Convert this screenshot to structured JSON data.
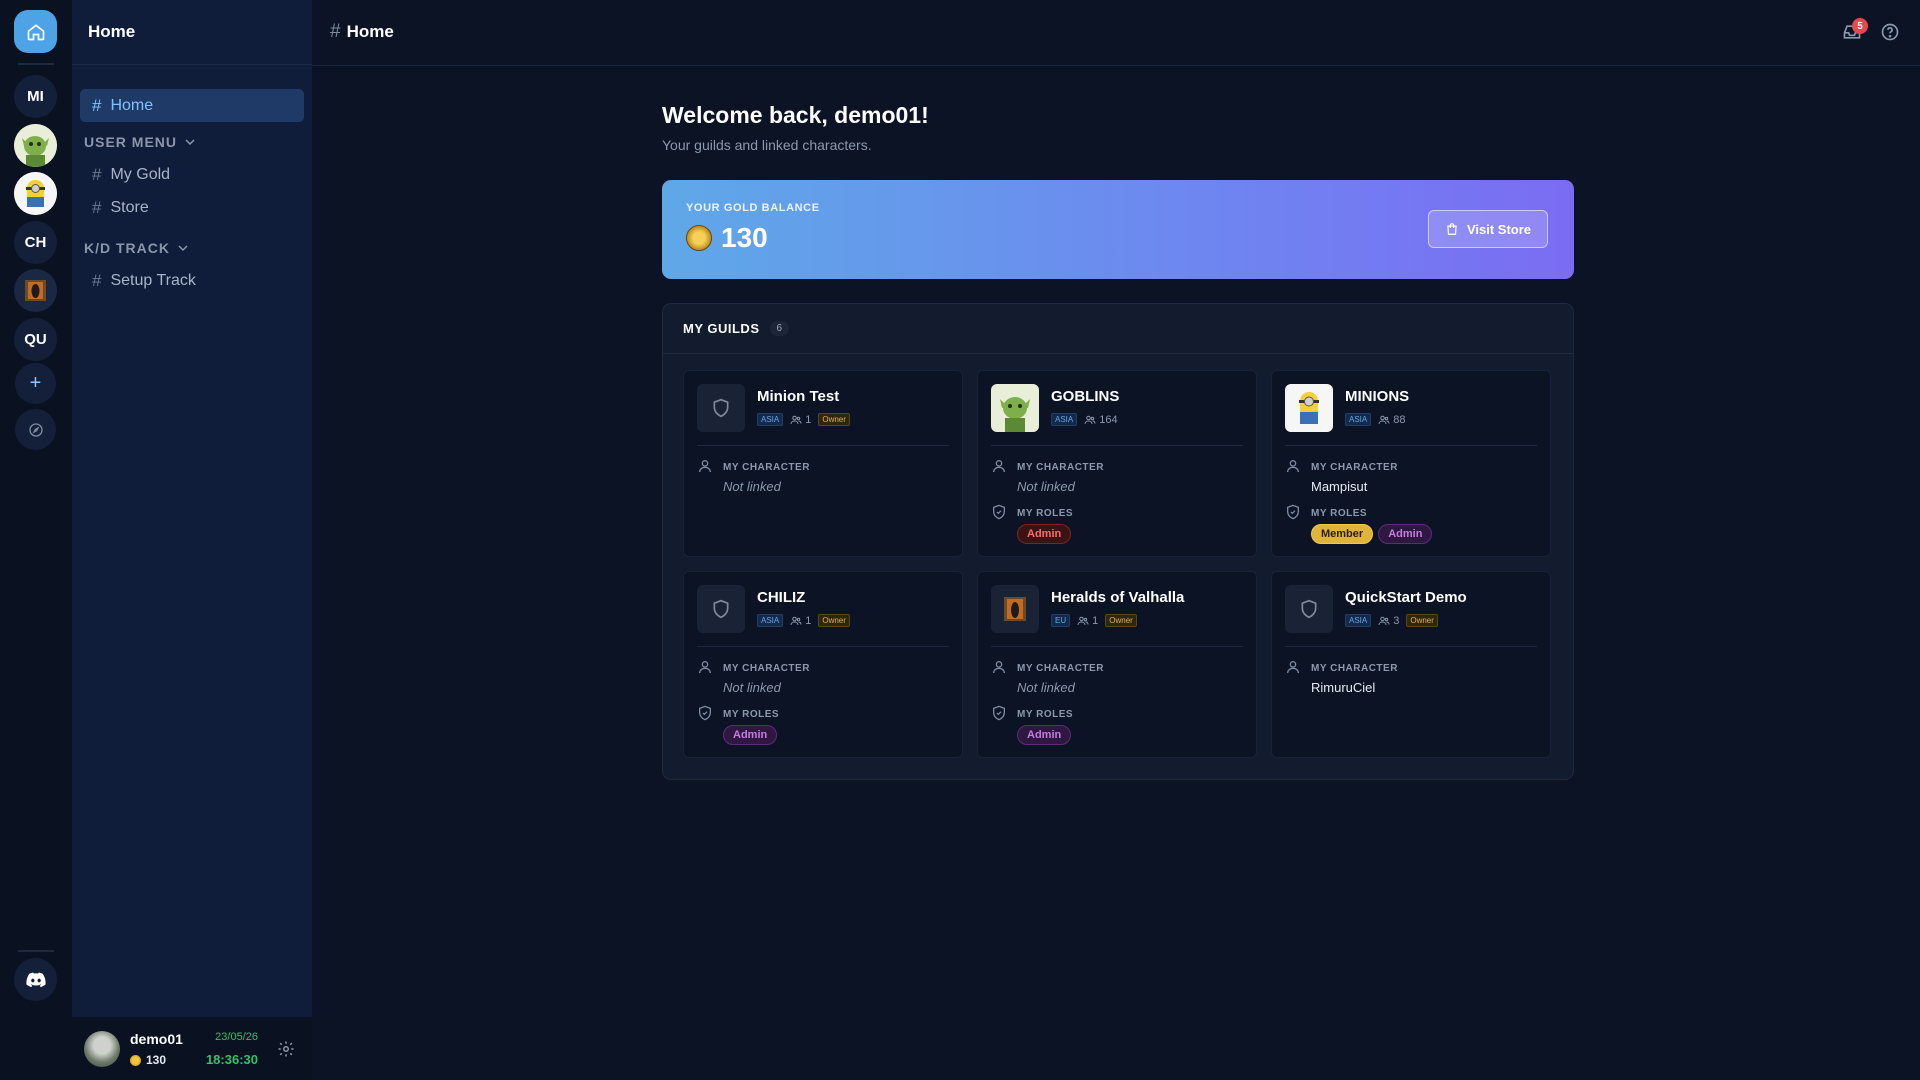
{
  "rail": {
    "items": [
      {
        "label": "MI"
      },
      {
        "label": ""
      },
      {
        "label": ""
      },
      {
        "label": "CH"
      },
      {
        "label": ""
      },
      {
        "label": "QU"
      }
    ],
    "add_label": "+",
    "home_icon": "home-icon",
    "explore_icon": "compass-icon",
    "discord_icon": "discord-icon"
  },
  "sidebar": {
    "title": "Home",
    "home_item": "Home",
    "sections": [
      {
        "label": "USER MENU",
        "items": [
          "My Gold",
          "Store"
        ]
      },
      {
        "label": "K/D TRACK",
        "items": [
          "Setup Track"
        ]
      }
    ]
  },
  "user": {
    "name": "demo01",
    "gold": "130",
    "date": "23/05/26",
    "time": "18:36:30"
  },
  "topbar": {
    "title": "Home",
    "notification_count": "5",
    "colors": {
      "badge": "#e5484d",
      "accent": "#4da3e6"
    }
  },
  "main": {
    "welcome": "Welcome back, demo01!",
    "subtitle": "Your guilds and linked characters.",
    "gold_card": {
      "label": "YOUR GOLD BALANCE",
      "value": "130",
      "button": "Visit Store"
    },
    "guilds_title": "MY GUILDS",
    "guilds_count": "6",
    "character_label": "MY CHARACTER",
    "roles_label": "MY ROLES",
    "guilds": [
      {
        "name": "Minion Test",
        "region": "ASIA",
        "members": "1",
        "owner": "Owner",
        "character": "Not linked",
        "roles": []
      },
      {
        "name": "GOBLINS",
        "region": "ASIA",
        "members": "164",
        "owner": "",
        "character": "Not linked",
        "roles": [
          "Admin"
        ]
      },
      {
        "name": "MINIONS",
        "region": "ASIA",
        "members": "88",
        "owner": "",
        "character": "Mampisut",
        "roles": [
          "Member",
          "Admin"
        ]
      },
      {
        "name": "CHILIZ",
        "region": "ASIA",
        "members": "1",
        "owner": "Owner",
        "character": "Not linked",
        "roles": [
          "Admin"
        ]
      },
      {
        "name": "Heralds of Valhalla",
        "region": "EU",
        "members": "1",
        "owner": "Owner",
        "character": "Not linked",
        "roles": [
          "Admin"
        ]
      },
      {
        "name": "QuickStart Demo",
        "region": "ASIA",
        "members": "3",
        "owner": "Owner",
        "character": "RimuruCiel",
        "roles": []
      }
    ]
  }
}
